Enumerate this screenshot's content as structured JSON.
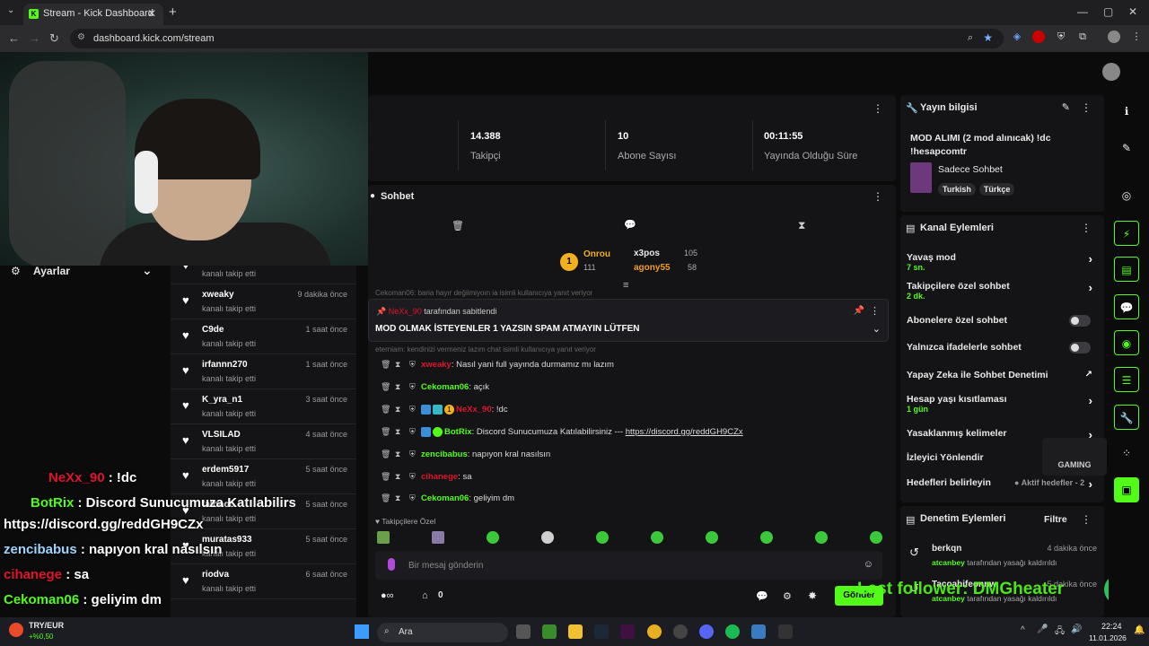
{
  "browser": {
    "tab_title": "Stream - Kick Dashboard",
    "url": "dashboard.kick.com/stream"
  },
  "settings": {
    "label": "Ayarlar"
  },
  "overlay_chat": [
    {
      "user": "NeXx_90",
      "text": " : !dc",
      "color": "#e0142b"
    },
    {
      "user": "BotRix",
      "text": " : Discord Sunucumuza Katılabilirs",
      "color": "#53fc18"
    },
    {
      "user": "",
      "text": "https://discord.gg/reddGH9CZx",
      "color": "#ffffff"
    },
    {
      "user": "zencibabus",
      "text": " : napıyon kral nasılsın",
      "color": "#9fd4ff"
    },
    {
      "user": "cihanege",
      "text": " : sa",
      "color": "#e0142b"
    },
    {
      "user": "Cekoman06",
      "text": " : geliyim dm",
      "color": "#53fc18"
    }
  ],
  "followers": [
    {
      "name": "",
      "sub": "kanalı takip etti",
      "time": ""
    },
    {
      "name": "xweaky",
      "sub": "kanalı takip etti",
      "time": "9 dakika önce"
    },
    {
      "name": "C9de",
      "sub": "kanalı takip etti",
      "time": "1 saat önce"
    },
    {
      "name": "irfannn270",
      "sub": "kanalı takip etti",
      "time": "1 saat önce"
    },
    {
      "name": "K_yra_n1",
      "sub": "kanalı takip etti",
      "time": "3 saat önce"
    },
    {
      "name": "VLSILAD",
      "sub": "kanalı takip etti",
      "time": "4 saat önce"
    },
    {
      "name": "erdem5917",
      "sub": "kanalı takip etti",
      "time": "5 saat önce"
    },
    {
      "name": "fatoooo",
      "sub": "kanalı takip etti",
      "time": "5 saat önce"
    },
    {
      "name": "muratas933",
      "sub": "kanalı takip etti",
      "time": "5 saat önce"
    },
    {
      "name": "riodva",
      "sub": "kanalı takip etti",
      "time": "6 saat önce"
    }
  ],
  "stats": [
    {
      "value": "14.388",
      "label": "Takipçi"
    },
    {
      "value": "10",
      "label": "Abone Sayısı"
    },
    {
      "value": "00:11:55",
      "label": "Yayında Olduğu Süre"
    }
  ],
  "chat": {
    "title": "Sohbet",
    "leaderboard": {
      "top": {
        "name": "Onrou",
        "score": "111"
      },
      "second": {
        "name": "x3pos",
        "score": "105"
      },
      "third": {
        "name": "agony55",
        "score": "58"
      }
    },
    "faded_1": "Cekoman06: baria hayır değiimiyoın ia isimli kullanıcıya yanıt veriyor",
    "pinned": {
      "by_user": "NeXx_90",
      "by_suffix": "tarafından sabitlendi",
      "message": "MOD OLMAK İSTEYENLER 1 YAZSIN SPAM ATMAYIN LÜTFEN"
    },
    "faded_2": "eterniam: kendinizi vermeniz lazım chat isimli kullanıcıya yanıt veriyor",
    "messages": [
      {
        "user": "xweaky",
        "text": ": Nasıl yani full yayında durmamız mı lazım",
        "color": "#e0142b"
      },
      {
        "user": "Cekoman06",
        "text": ": açık",
        "color": "#53fc18"
      },
      {
        "user": "NeXx_90",
        "text": ": !dc",
        "color": "#e0142b"
      },
      {
        "user": "BotRix",
        "text": ": Discord Sunucumuza Katılabilirsiniz --- ",
        "link": "https://discord.gg/reddGH9CZx",
        "color": "#53fc18"
      },
      {
        "user": "zencibabus",
        "text": ": napıyon kral nasılsın",
        "color": "#53fc18"
      },
      {
        "user": "cihanege",
        "text": ": sa",
        "color": "#e0142b"
      },
      {
        "user": "Cekoman06",
        "text": ": geliyim dm",
        "color": "#53fc18"
      }
    ],
    "emote_section": "Takipçilere Özel",
    "input_placeholder": "Bir mesaj gönderin",
    "points": "0",
    "send": "Gönder"
  },
  "yayin": {
    "title": "Yayın bilgisi",
    "stream_title": "MOD ALIMI (2 mod alınıcak) !dc !hesapcomtr",
    "category": "Sadece Sohbet",
    "tags": [
      "Turkish",
      "Türkçe"
    ]
  },
  "kanal": {
    "title": "Kanal Eylemleri",
    "items": [
      {
        "label": "Yavaş mod",
        "sub": "7 sn."
      },
      {
        "label": "Takipçilere özel sohbet",
        "sub": "2 dk."
      },
      {
        "label": "Abonelere özel sohbet"
      },
      {
        "label": "Yalnızca ifadelerle sohbet"
      },
      {
        "label": "Yapay Zeka ile Sohbet Denetimi"
      },
      {
        "label": "Hesap yaşı kısıtlaması",
        "sub": "1 gün"
      },
      {
        "label": "Yasaklanmış kelimeler"
      },
      {
        "label": "İzleyici Yönlendir"
      },
      {
        "label": "Hedefleri belirleyin",
        "sub": "Aktif hedefler - 2"
      }
    ]
  },
  "denetim": {
    "title": "Denetim Eylemleri",
    "filter": "Filtre",
    "items": [
      {
        "user": "berkqn",
        "by": "atcanbey",
        "action": "tarafından yasağı kaldırıldı",
        "time": "4 dakika önce"
      },
      {
        "user": "Tacoahifeonnw",
        "by": "atcanbey",
        "action": "tarafından yasağı kaldırıldı",
        "time": "5 dakika önce"
      }
    ]
  },
  "overlay_text": {
    "last_follower": "Last follower: DMGheater",
    "brand": "GAMING"
  },
  "taskbar": {
    "ticker": "TRY/EUR",
    "ticker_change": "+%0,50",
    "search": "Ara",
    "time": "22:24",
    "date": "11.01.2026"
  },
  "colors": {
    "accent": "#53fc18",
    "panel": "#141416",
    "bg": "#0b0b0c"
  }
}
